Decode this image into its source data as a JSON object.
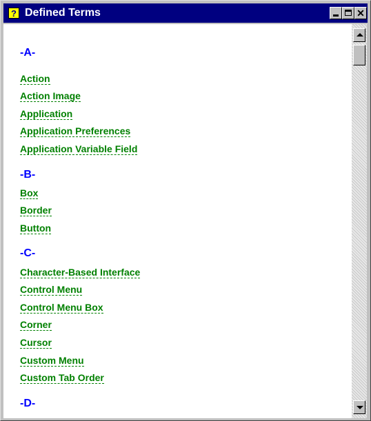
{
  "window": {
    "title": "Defined Terms",
    "help_icon_glyph": "?",
    "minimize_icon": "minimize-icon",
    "maximize_icon": "maximize-icon",
    "close_glyph": "✕"
  },
  "colors": {
    "titlebar": "#000080",
    "section_header": "#0000ff",
    "term_link": "#008000"
  },
  "sections": [
    {
      "header": "-A-",
      "terms": [
        "Action",
        "Action Image",
        "Application",
        "Application Preferences",
        "Application Variable Field"
      ]
    },
    {
      "header": "-B-",
      "terms": [
        "Box",
        "Border",
        "Button"
      ]
    },
    {
      "header": "-C-",
      "terms": [
        "Character-Based Interface",
        "Control Menu",
        "Control Menu Box",
        "Corner",
        "Cursor",
        "Custom Menu",
        "Custom Tab Order"
      ]
    },
    {
      "header": "-D-",
      "terms": []
    }
  ]
}
